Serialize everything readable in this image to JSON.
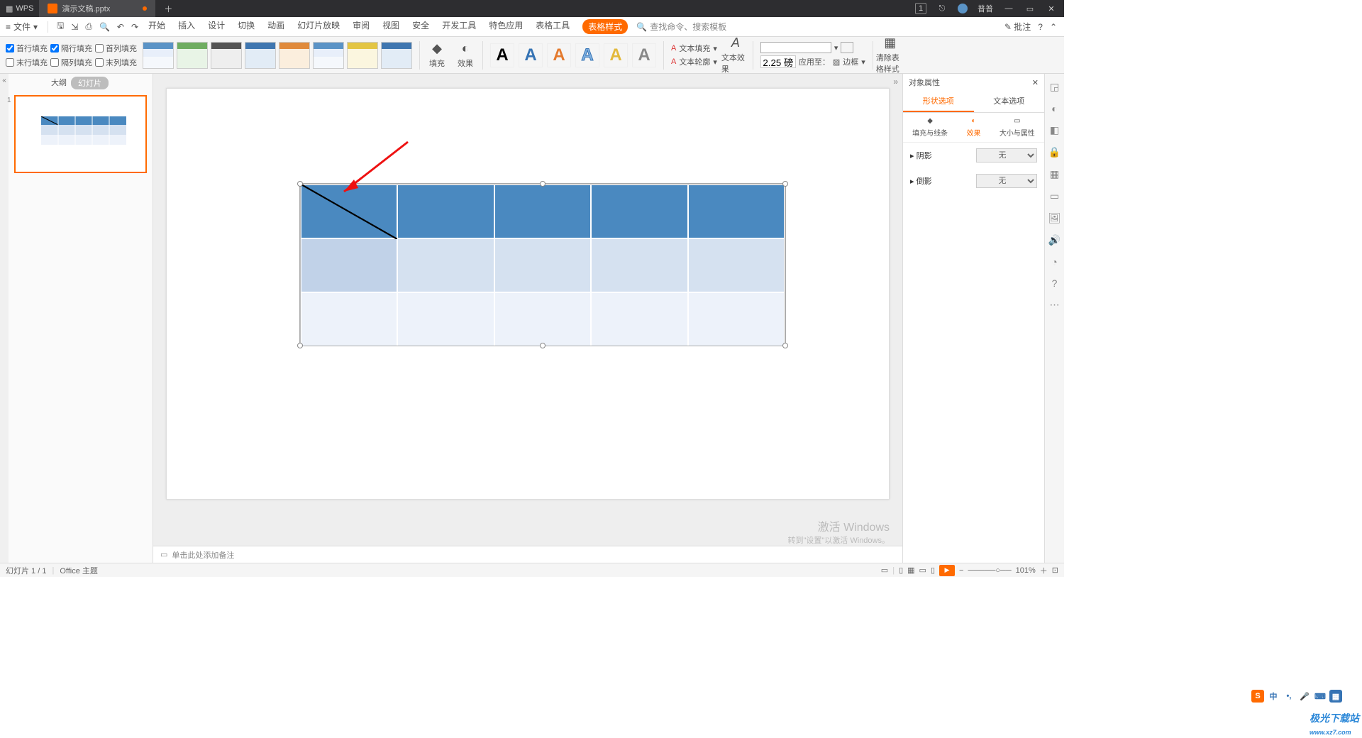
{
  "titlebar": {
    "app": "WPS",
    "tab_label": "演示文稿.pptx",
    "user": "普普",
    "badge": "1"
  },
  "menubar": {
    "file": "文件",
    "tabs": [
      "开始",
      "插入",
      "设计",
      "切换",
      "动画",
      "幻灯片放映",
      "审阅",
      "视图",
      "安全",
      "开发工具",
      "特色应用",
      "表格工具"
    ],
    "active_tab": "表格样式",
    "search_placeholder": "查找命令、搜索模板",
    "annotate": "批注"
  },
  "ribbon": {
    "checks_left": [
      {
        "label": "首行填充",
        "checked": true
      },
      {
        "label": "末行填充",
        "checked": false
      }
    ],
    "checks_mid": [
      {
        "label": "隔行填充",
        "checked": true
      },
      {
        "label": "隔列填充",
        "checked": false
      }
    ],
    "checks_right": [
      {
        "label": "首列填充",
        "checked": false
      },
      {
        "label": "末列填充",
        "checked": false
      }
    ],
    "fill_btn": "填充",
    "effect_btn": "效果",
    "text_fill": "文本填充",
    "text_outline": "文本轮廓",
    "text_effect": "文本效果",
    "line_width": "2.25 磅",
    "apply_to": "应用至：",
    "border": "边框",
    "clear_style": "清除表格样式"
  },
  "thumbs": {
    "outline": "大纲",
    "slides": "幻灯片",
    "slide_num": "1"
  },
  "notes": "单击此处添加备注",
  "rpanel": {
    "title": "对象属性",
    "tab_shape": "形状选项",
    "tab_text": "文本选项",
    "sub_fill": "填充与线条",
    "sub_effect": "效果",
    "sub_size": "大小与属性",
    "shadow": "阴影",
    "shadow_val": "无",
    "reflect": "倒影",
    "reflect_val": "无"
  },
  "statusbar": {
    "slide_pos": "幻灯片 1 / 1",
    "theme": "Office 主题",
    "zoom": "101%"
  },
  "watermark": {
    "l1": "激活 Windows",
    "l2": "转到\"设置\"以激活 Windows。"
  },
  "brand": "极光下载站",
  "brand_url": "www.xz7.com"
}
